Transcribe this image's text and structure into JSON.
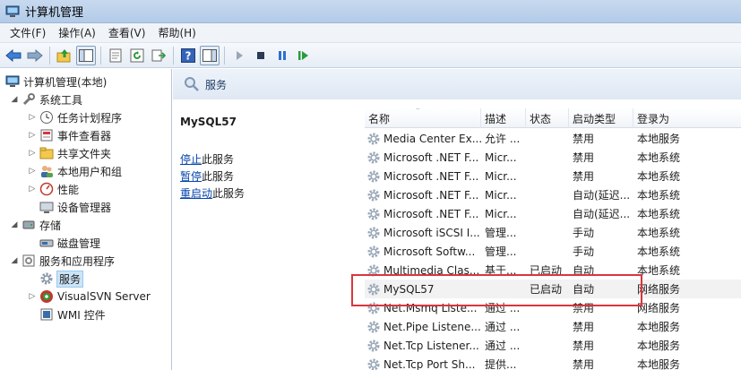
{
  "window": {
    "title": "计算机管理"
  },
  "menu": [
    "文件(F)",
    "操作(A)",
    "查看(V)",
    "帮助(H)"
  ],
  "toolbar": {
    "buttons": [
      "back-icon",
      "forward-icon",
      "up-icon",
      "show-tree-icon",
      "properties-icon",
      "refresh-icon",
      "export-icon",
      "help-icon",
      "show-hide-icon",
      "play-icon",
      "stop-icon",
      "pause-icon",
      "resume-icon"
    ],
    "colors": {
      "play": "#2b9a3e",
      "stop": "#2b3a55",
      "pause": "#2f6fcf"
    }
  },
  "tree": {
    "root": "计算机管理(本地)",
    "items": [
      {
        "label": "系统工具",
        "level": 1,
        "arrow": "◢"
      },
      {
        "label": "任务计划程序",
        "level": 2,
        "arrow": "▷"
      },
      {
        "label": "事件查看器",
        "level": 2,
        "arrow": "▷"
      },
      {
        "label": "共享文件夹",
        "level": 2,
        "arrow": "▷"
      },
      {
        "label": "本地用户和组",
        "level": 2,
        "arrow": "▷"
      },
      {
        "label": "性能",
        "level": 2,
        "arrow": "▷"
      },
      {
        "label": "设备管理器",
        "level": 2,
        "arrow": ""
      },
      {
        "label": "存储",
        "level": 1,
        "arrow": "◢"
      },
      {
        "label": "磁盘管理",
        "level": 2,
        "arrow": ""
      },
      {
        "label": "服务和应用程序",
        "level": 1,
        "arrow": "◢"
      },
      {
        "label": "服务",
        "level": 2,
        "arrow": ""
      },
      {
        "label": "VisualSVN Server",
        "level": 2,
        "arrow": "▷"
      },
      {
        "label": "WMI 控件",
        "level": 2,
        "arrow": ""
      }
    ]
  },
  "pane": {
    "title": "服务",
    "selected_service": "MySQL57",
    "actions": [
      {
        "link": "停止",
        "rest": "此服务"
      },
      {
        "link": "暂停",
        "rest": "此服务"
      },
      {
        "link": "重启动",
        "rest": "此服务"
      }
    ]
  },
  "list": {
    "headers": [
      "名称",
      "描述",
      "状态",
      "启动类型",
      "登录为"
    ],
    "rows": [
      [
        "Media Center Ex...",
        "允许 ...",
        "",
        "禁用",
        "本地服务"
      ],
      [
        "Microsoft .NET F...",
        "Micr...",
        "",
        "禁用",
        "本地系统"
      ],
      [
        "Microsoft .NET F...",
        "Micr...",
        "",
        "禁用",
        "本地系统"
      ],
      [
        "Microsoft .NET F...",
        "Micr...",
        "",
        "自动(延迟...",
        "本地系统"
      ],
      [
        "Microsoft .NET F...",
        "Micr...",
        "",
        "自动(延迟...",
        "本地系统"
      ],
      [
        "Microsoft iSCSI I...",
        "管理...",
        "",
        "手动",
        "本地系统"
      ],
      [
        "Microsoft Softw...",
        "管理...",
        "",
        "手动",
        "本地系统"
      ],
      [
        "Multimedia Clas...",
        "基于...",
        "已启动",
        "自动",
        "本地系统"
      ],
      [
        "MySQL57",
        "",
        "已启动",
        "自动",
        "网络服务"
      ],
      [
        "Net.Msmq Liste...",
        "通过 ...",
        "",
        "禁用",
        "网络服务"
      ],
      [
        "Net.Pipe Listene...",
        "通过 ...",
        "",
        "禁用",
        "本地服务"
      ],
      [
        "Net.Tcp Listener...",
        "通过 ...",
        "",
        "禁用",
        "本地服务"
      ],
      [
        "Net.Tcp Port Sh...",
        "提供...",
        "",
        "禁用",
        "本地服务"
      ]
    ],
    "selected_row": 8
  },
  "accent": {
    "highlight_box": "#d9363e",
    "selection": "#cce4f7"
  }
}
